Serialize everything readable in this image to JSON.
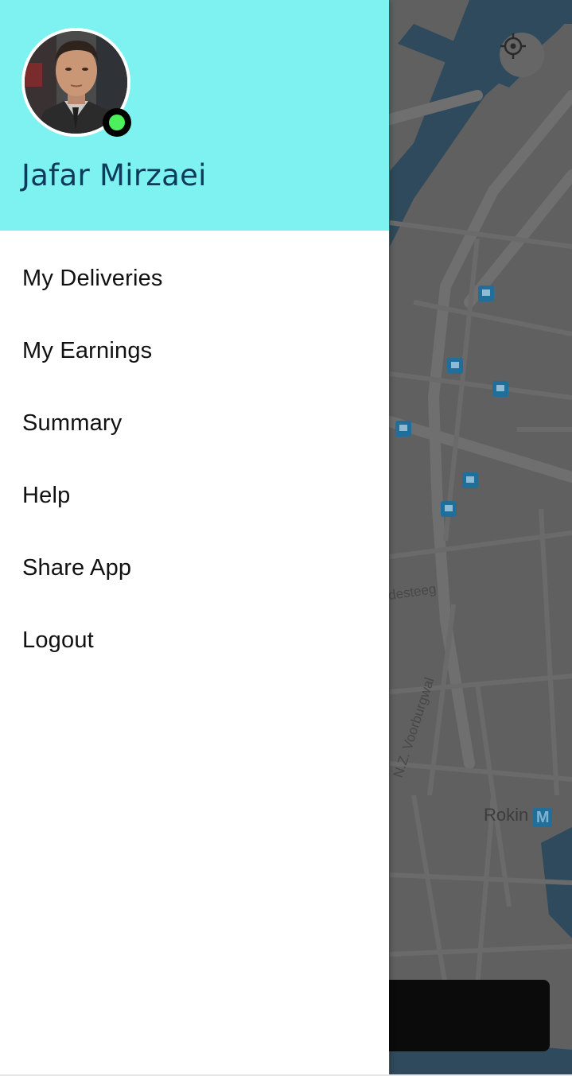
{
  "user": {
    "name": "Jafar Mirzaei",
    "status": "online",
    "status_color": "#4cf05d"
  },
  "header": {
    "background_color": "#7df2f0"
  },
  "menu": {
    "items": [
      {
        "label": "My Deliveries"
      },
      {
        "label": "My Earnings"
      },
      {
        "label": "Summary"
      },
      {
        "label": "Help"
      },
      {
        "label": "Share App"
      },
      {
        "label": "Logout"
      }
    ]
  },
  "map": {
    "labels": {
      "street_1": "desteeg",
      "street_2": "N.Z. Voorburgwal",
      "station": "Rokin",
      "metro_badge": "M"
    },
    "icons": [
      "crosshair-icon",
      "tram-stop-icon",
      "metro-icon"
    ]
  }
}
